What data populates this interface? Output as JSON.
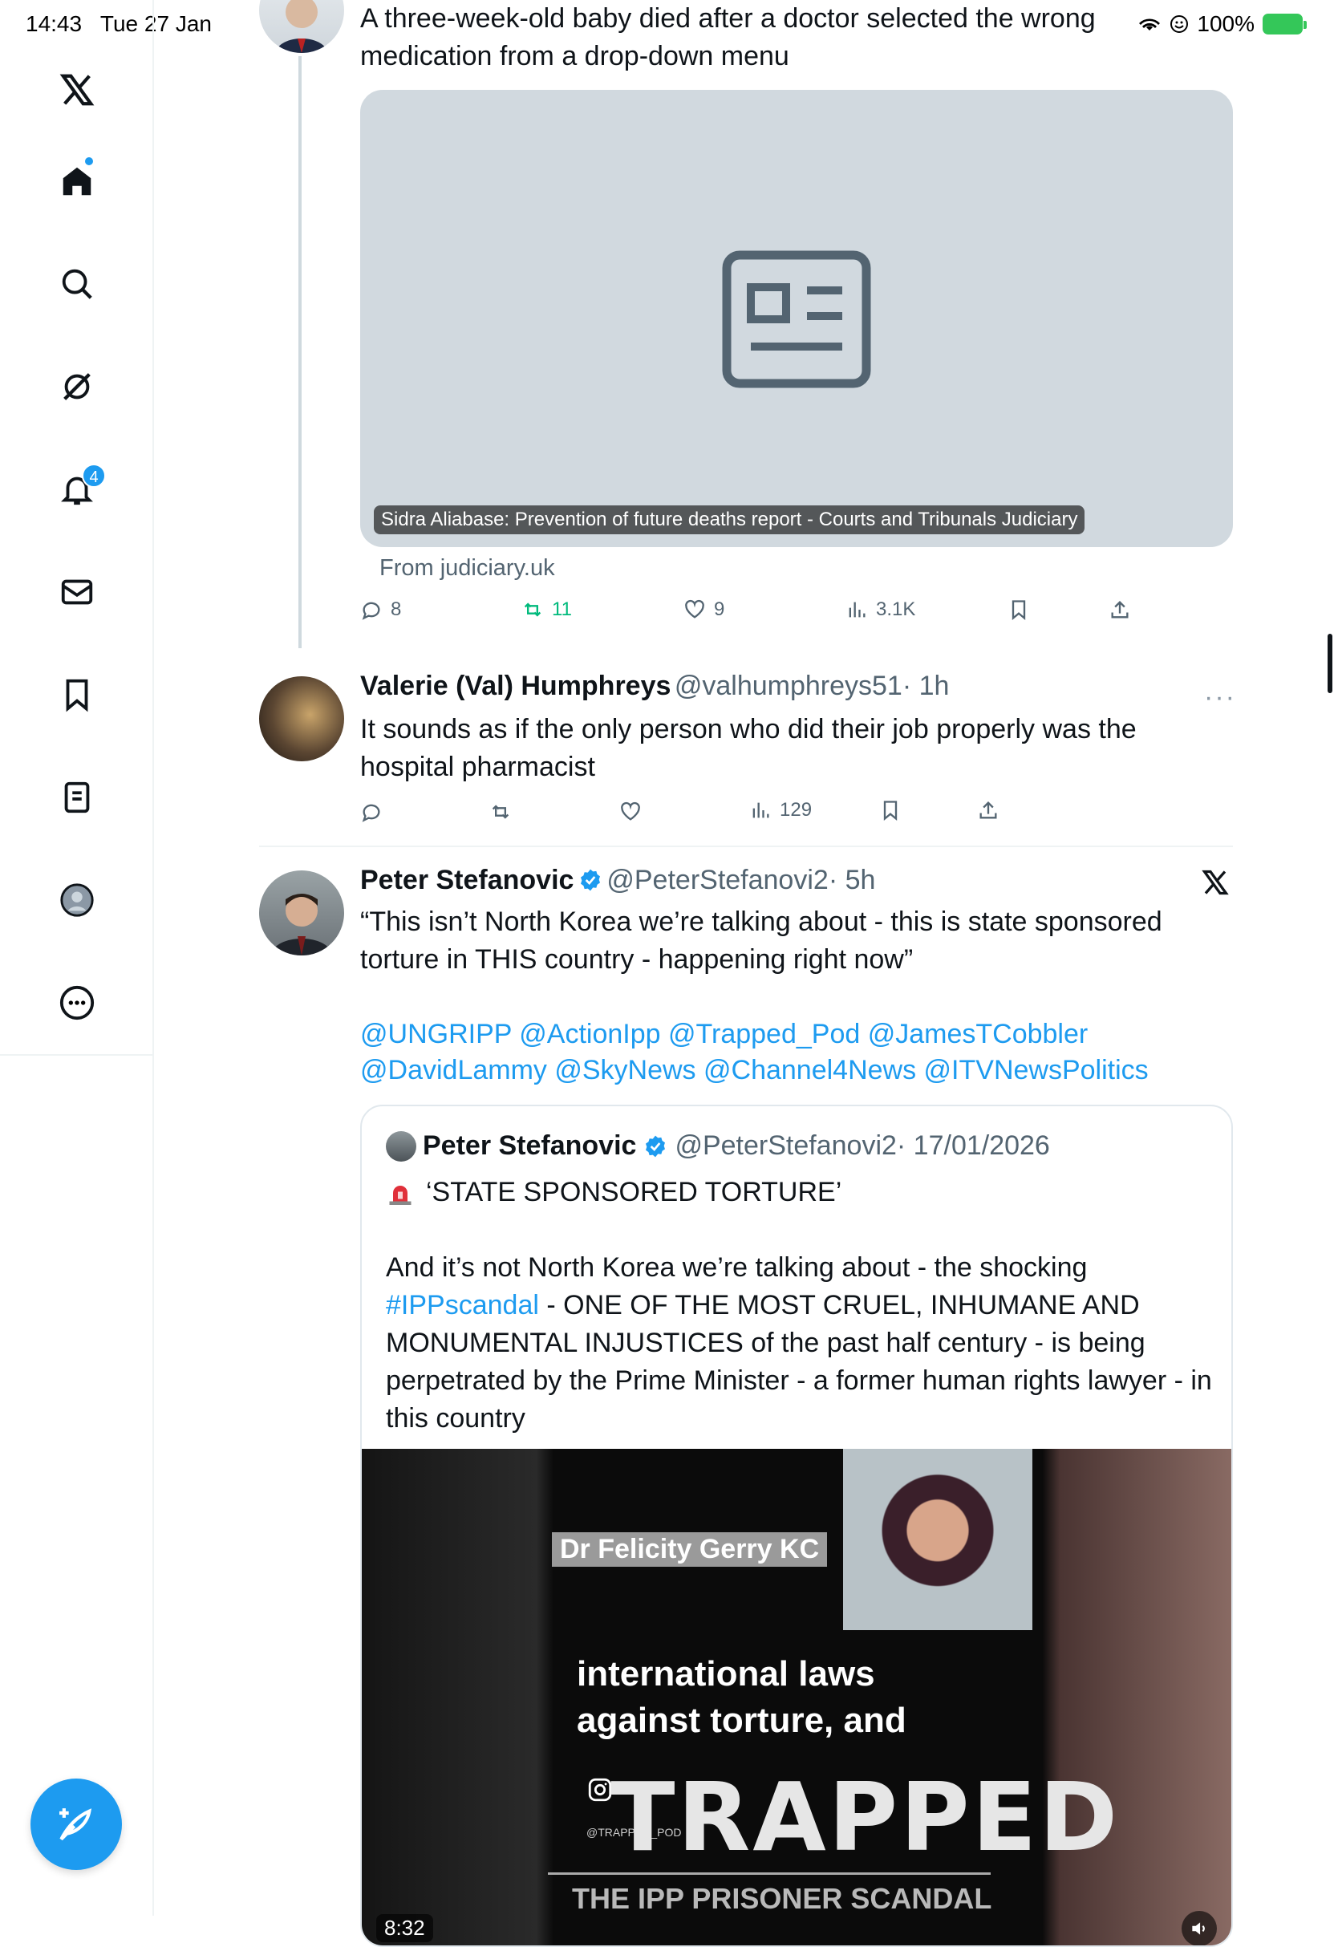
{
  "status_bar": {
    "time": "14:43",
    "date": "Tue 27 Jan",
    "battery": "100%"
  },
  "sidebar": {
    "items": [
      {
        "name": "x-logo-icon"
      },
      {
        "name": "home-icon"
      },
      {
        "name": "search-icon"
      },
      {
        "name": "grok-icon"
      },
      {
        "name": "notifications-icon",
        "badge": "4"
      },
      {
        "name": "messages-icon"
      },
      {
        "name": "bookmarks-icon"
      },
      {
        "name": "lists-icon"
      },
      {
        "name": "profile-icon"
      },
      {
        "name": "more-icon"
      }
    ]
  },
  "tweet1": {
    "text": "A three-week-old baby died after a doctor selected the wrong medication from a drop-down menu",
    "card_caption": "Sidra Aliabase: Prevention of future deaths report - Courts and Tribunals Judiciary",
    "card_source": "From judiciary.uk",
    "replies": "8",
    "retweets": "11",
    "likes": "9",
    "views": "3.1K"
  },
  "tweet2": {
    "name": "Valerie (Val) Humphreys",
    "handle": "@valhumphreys51",
    "time": "· 1h",
    "text": "It sounds as if the only person who did their job properly was the hospital pharmacist",
    "views": "129"
  },
  "tweet3": {
    "name": "Peter Stefanovic",
    "handle": "@PeterStefanovi2",
    "time": "· 5h",
    "text": "“This isn’t North Korea we’re talking about  - this is state sponsored torture in THIS country - happening right now”",
    "mentions_line1": "@UNGRIPP @ActionIpp @Trapped_Pod @JamesTCobbler",
    "mentions_line2": "@DavidLammy @SkyNews @Channel4News @ITVNewsPolitics"
  },
  "quote": {
    "name": "Peter Stefanovic",
    "handle": "@PeterStefanovi2",
    "date": "· 17/01/2026",
    "headline": "‘STATE SPONSORED TORTURE’",
    "body_before": "And it’s not North Korea we’re talking about - the shocking ",
    "hashtag": "#IPPscandal",
    "body_after": " - ONE OF THE MOST CRUEL, INHUMANE AND MONUMENTAL INJUSTICES of the past half century - is being perpetrated by the Prime Minister - a former human rights lawyer - in this country",
    "video": {
      "name_tag": "Dr Felicity Gerry KC",
      "subtitle": "international laws against torture, and",
      "title": "TRAPPED",
      "strapline": "THE IPP PRISONER SCANDAL",
      "insta_handle": "@TRAPPED_POD",
      "duration": "8:32"
    }
  },
  "colors": {
    "accent": "#1d9bf0",
    "retweet_green": "#00ba7c",
    "muted": "#536471"
  }
}
